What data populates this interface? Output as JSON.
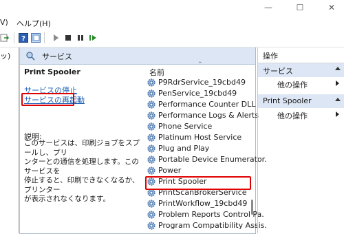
{
  "menu": {
    "view_fragment": "V)",
    "help": "ヘルプ(H)"
  },
  "left_tree": {
    "fragment": "ッ)"
  },
  "center": {
    "header_title": "サービス",
    "selected_service": "Print Spooler",
    "links": {
      "stop": "サービスの停止",
      "restart": "サービスの再起動"
    },
    "description_label": "説明:",
    "description_lines": [
      "このサービスは、印刷ジョブをスプールし、プリ",
      "ンターとの通信を処理します。このサービスを",
      "停止すると、印刷できなくなるか、プリンター",
      "が表示されなくなります。"
    ],
    "column_name": "名前",
    "services": [
      "P9RdrService_19cbd49",
      "PenService_19cbd49",
      "Performance Counter DLL H.",
      "Performance Logs & Alerts",
      "Phone Service",
      "Platinum Host Service",
      "Plug and Play",
      "Portable Device Enumerator.",
      "Power",
      "Print Spooler",
      "PrintScanBrokerService",
      "PrintWorkflow_19cbd49",
      "Problem Reports Control Pa.",
      "Program Compatibility Assis."
    ]
  },
  "actions": {
    "title": "操作",
    "sections": [
      {
        "label": "サービス",
        "item": "他の操作"
      },
      {
        "label": "Print Spooler",
        "item": "他の操作"
      }
    ]
  },
  "colors": {
    "highlight_border": "#e00000",
    "header_bg": "#dce6f4",
    "link": "#1a5fb4"
  }
}
